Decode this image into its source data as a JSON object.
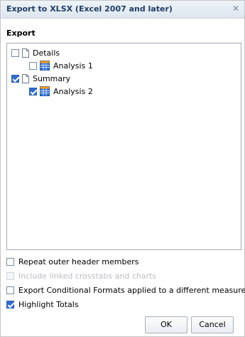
{
  "dialog": {
    "title": "Export to XLSX (Excel 2007 and later)",
    "close_glyph": "✕"
  },
  "export_section": {
    "label": "Export",
    "tree": [
      {
        "label": "Details",
        "checked": false,
        "icon": "document-icon",
        "children": [
          {
            "label": "Analysis 1",
            "checked": false,
            "icon": "table-grid-icon"
          }
        ]
      },
      {
        "label": "Summary",
        "checked": true,
        "icon": "document-icon",
        "children": [
          {
            "label": "Analysis 2",
            "checked": true,
            "icon": "table-grid-icon"
          }
        ]
      }
    ]
  },
  "options": [
    {
      "label": "Repeat outer header members",
      "checked": false,
      "enabled": true
    },
    {
      "label": "Include linked crosstabs and charts",
      "checked": false,
      "enabled": false
    },
    {
      "label": "Export Conditional Formats applied to a different measure",
      "checked": false,
      "enabled": true
    },
    {
      "label": "Highlight Totals",
      "checked": true,
      "enabled": true
    }
  ],
  "buttons": {
    "ok_label": "OK",
    "cancel_label": "Cancel"
  },
  "colors": {
    "title_text": "#1f3d66",
    "checkbox_checked": "#2f6dd1",
    "grid_icon_blue": "#2c6fd6"
  }
}
